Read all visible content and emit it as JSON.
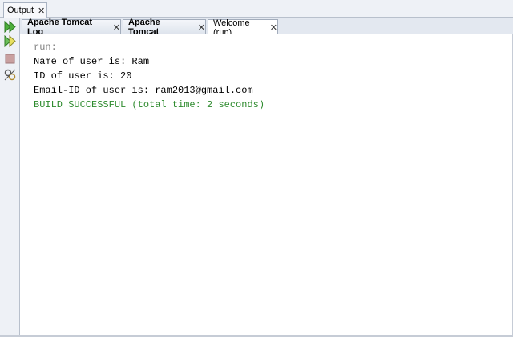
{
  "outer_tab": {
    "label": "Output",
    "close": "✕"
  },
  "left_toolbar": {
    "buttons": [
      {
        "icon": "rerun-icon",
        "color": "#3f9c2f"
      },
      {
        "icon": "rerun-with-options-icon",
        "color": "#3f9c2f"
      },
      {
        "icon": "stop-icon",
        "color": "#c99a9a"
      },
      {
        "icon": "settings-icon",
        "color": "#555555"
      }
    ]
  },
  "tabs": [
    {
      "label": "Apache Tomcat Log",
      "close": "✕"
    },
    {
      "label": "Apache Tomcat",
      "close": "✕"
    },
    {
      "label": "Welcome (run)",
      "close": "✕"
    }
  ],
  "console": {
    "lines": [
      {
        "text": "run:",
        "color": "#808080"
      },
      {
        "text": "Name of user is: Ram",
        "color": "#000000"
      },
      {
        "text": "ID of user is: 20",
        "color": "#000000"
      },
      {
        "text": "Email-ID of user is: ram2013@gmail.com",
        "color": "#000000"
      },
      {
        "text": "BUILD SUCCESSFUL (total time: 2 seconds)",
        "color": "#2e8b2e"
      }
    ]
  }
}
